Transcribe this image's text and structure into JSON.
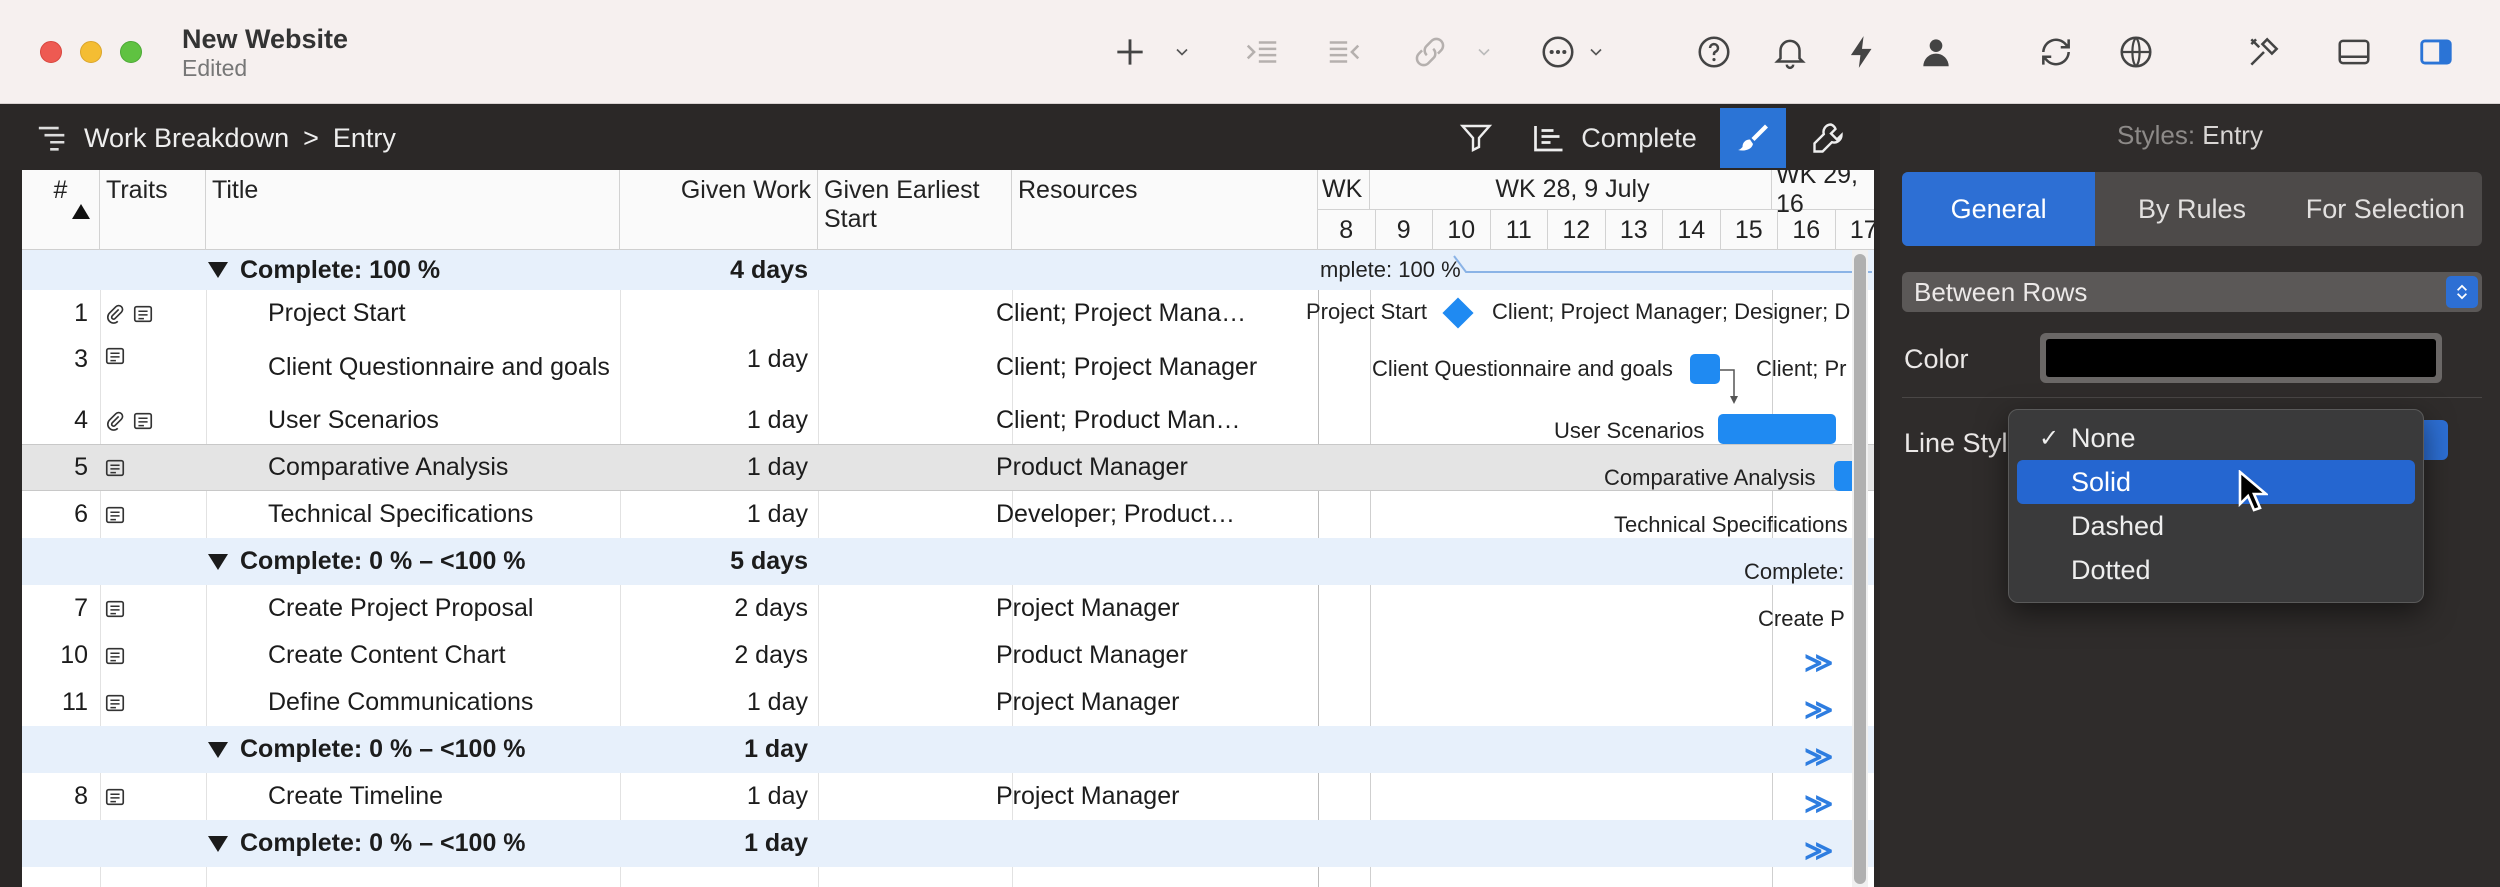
{
  "window": {
    "title": "New Website",
    "subtitle": "Edited"
  },
  "breadcrumb": {
    "root": "Work Breakdown",
    "separator": ">",
    "current": "Entry"
  },
  "subtoolbar": {
    "complete_label": "Complete"
  },
  "columns": {
    "num": "#",
    "traits": "Traits",
    "title": "Title",
    "given_work": "Given Work",
    "given_earliest_start": "Given Earliest Start",
    "resources": "Resources"
  },
  "rows": [
    {
      "kind": "group",
      "title": "Complete: 100 %",
      "work": "4 days"
    },
    {
      "kind": "task",
      "num": "1",
      "title": "Project Start",
      "work": "",
      "resources": "Client; Project Mana…"
    },
    {
      "kind": "task",
      "num": "3",
      "title": "Client Questionnaire and goals",
      "work": "1 day",
      "resources": "Client; Project Manager"
    },
    {
      "kind": "task",
      "num": "4",
      "title": "User Scenarios",
      "work": "1 day",
      "resources": "Client; Product Man…"
    },
    {
      "kind": "task",
      "num": "5",
      "title": "Comparative Analysis",
      "work": "1 day",
      "resources": "Product Manager"
    },
    {
      "kind": "task",
      "num": "6",
      "title": "Technical Specifications",
      "work": "1 day",
      "resources": "Developer; Product…"
    },
    {
      "kind": "group",
      "title": "Complete: 0 % – <100 %",
      "work": "5 days"
    },
    {
      "kind": "task",
      "num": "7",
      "title": "Create Project Proposal",
      "work": "2 days",
      "resources": "Project Manager"
    },
    {
      "kind": "task",
      "num": "10",
      "title": "Create Content Chart",
      "work": "2 days",
      "resources": "Product Manager"
    },
    {
      "kind": "task",
      "num": "11",
      "title": "Define Communications",
      "work": "1 day",
      "resources": "Project Manager"
    },
    {
      "kind": "group",
      "title": "Complete: 0 % – <100 %",
      "work": "1 day"
    },
    {
      "kind": "task",
      "num": "8",
      "title": "Create Timeline",
      "work": "1 day",
      "resources": "Project Manager"
    },
    {
      "kind": "group",
      "title": "Complete: 0 % – <100 %",
      "work": "1 day"
    }
  ],
  "gantt": {
    "weeks": [
      "WK",
      "WK 28, 9 July",
      "WK 29, 16"
    ],
    "days": [
      "8",
      "9",
      "10",
      "11",
      "12",
      "13",
      "14",
      "15",
      "16",
      "17"
    ],
    "labels": {
      "group1": "mplete: 100 %",
      "project_start": "Project Start",
      "project_start_res": "Client; Project Manager; Designer; D",
      "questionnaire": "Client Questionnaire and goals",
      "questionnaire_res": "Client; Pr",
      "user_scenarios": "User Scenarios",
      "comparative": "Comparative Analysis",
      "technical": "Technical Specifications",
      "group2": "Complete:",
      "proposal": "Create P",
      "more": "≫"
    }
  },
  "inspector": {
    "title_prefix": "Styles:",
    "title_value": "Entry",
    "tabs": [
      "General",
      "By Rules",
      "For Selection"
    ],
    "scope_value": "Between Rows",
    "color_label": "Color",
    "color_value": "#000000",
    "line_style_label": "Line Styl"
  },
  "line_style_menu": {
    "items": [
      "None",
      "Solid",
      "Dashed",
      "Dotted"
    ],
    "checked": "None",
    "highlighted": "Solid",
    "check_mark": "✓"
  },
  "colors": {
    "accent": "#2d6fd4",
    "bar": "#1f8af2",
    "group_row": "#e7f0fb"
  }
}
